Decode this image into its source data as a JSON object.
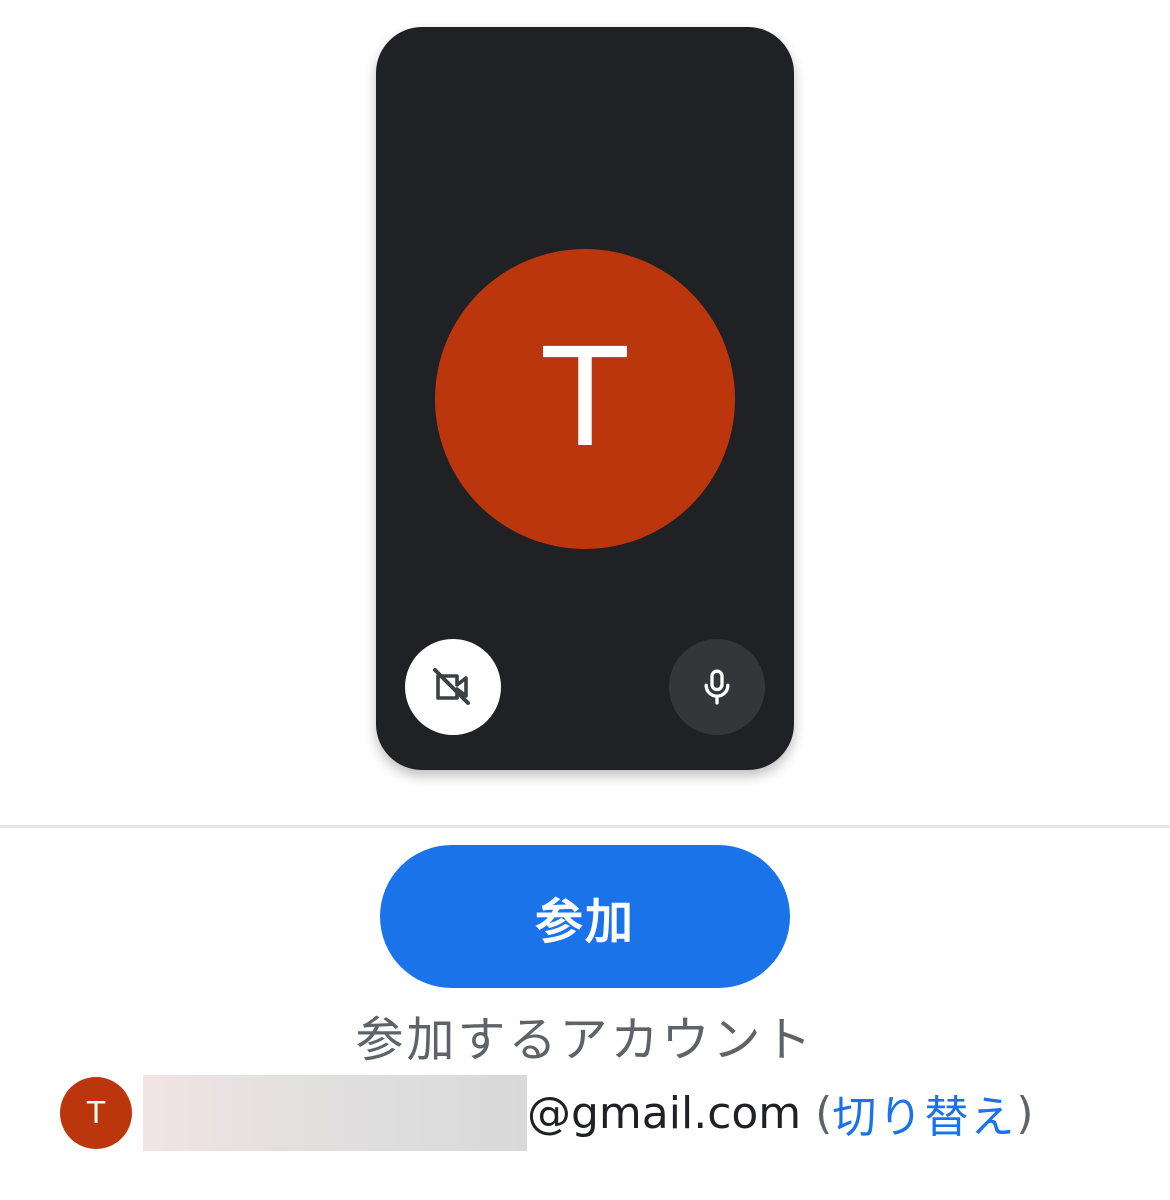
{
  "preview": {
    "avatar_initial": "T",
    "camera_icon": "videocam-off-icon",
    "mic_icon": "mic-icon"
  },
  "join_button": {
    "label": "参加"
  },
  "account": {
    "label": "参加するアカウント",
    "avatar_initial": "T",
    "email_suffix": "@gmail.com",
    "paren_open": "(",
    "switch_label": "切り替え",
    "paren_close": ")"
  },
  "colors": {
    "preview_bg": "#202124",
    "avatar_bg": "#bb360c",
    "primary": "#1a73e8",
    "secondary_text": "#5f6368"
  }
}
